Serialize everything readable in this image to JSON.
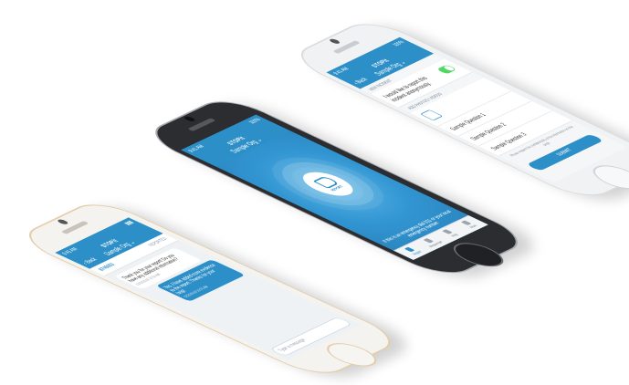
{
  "phones": {
    "right": {
      "time": "9:41 AM",
      "battery": "100%",
      "brand": "STOPit",
      "org": "Sample Org",
      "back": "Back",
      "new_incident": "NEW INCIDENT",
      "report_anon": "I would like to report this incident anonymously.",
      "add_label": "ADD PHOTOS / VIDEOS",
      "q1": "Sample Question 1",
      "q2": "Sample Question 2",
      "q3": "Sample Question 3",
      "disclaimer": "Please respect the confidentiality of the information on this page.",
      "submit": "SUBMIT"
    },
    "center": {
      "time": "9:41 AM",
      "battery": "100%",
      "brand": "STOPit",
      "org": "Sample Org",
      "report": "REPORT",
      "emergency": "If this is an emergency dial 911 or your local emergency number",
      "tabs": [
        "Report",
        "Messenger",
        "Help",
        "More"
      ]
    },
    "left": {
      "time": "9:41 AM",
      "brand": "STOPit",
      "org": "Sample Org",
      "back": "Back",
      "incident_id": "8745053",
      "reported": "REPORTED",
      "msg_in": "Thank you for your report! Do you have any additional information?",
      "msg_in_time": "02/20/2018 10:54 AM",
      "msg_out": "Yes, I have added more evidence to the report. Thanks for your help!",
      "msg_out_time": "02/20/2018 10:55 AM",
      "input_placeholder": "Type a message"
    }
  },
  "colors": {
    "brand_blue": "#2d8fc8",
    "toggle_green": "#4cd964"
  }
}
